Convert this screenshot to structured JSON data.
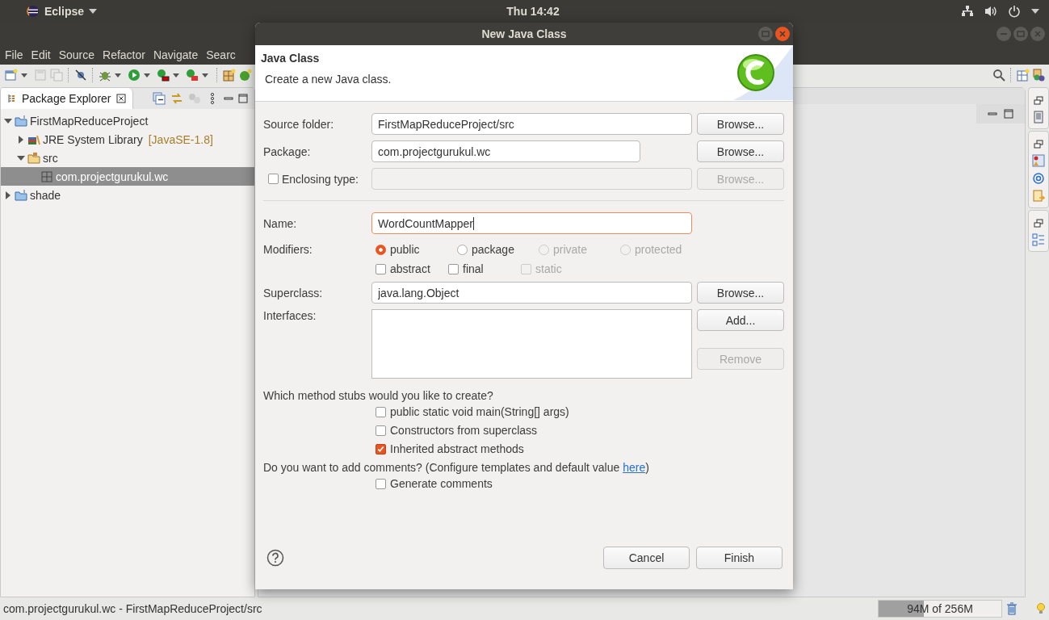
{
  "top_bar": {
    "app_menu": "Eclipse",
    "clock": "Thu 14:42"
  },
  "menu_bar": [
    "File",
    "Edit",
    "Source",
    "Refactor",
    "Navigate",
    "Searc"
  ],
  "explorer": {
    "title": "Package Explorer",
    "tree": [
      {
        "label": "FirstMapReduceProject",
        "kind": "project",
        "expanded": true,
        "selected": false,
        "children": [
          {
            "label": "JRE System Library",
            "suffix": "[JavaSE-1.8]",
            "kind": "library",
            "expanded": false,
            "selected": false
          },
          {
            "label": "src",
            "kind": "folder",
            "expanded": true,
            "selected": false,
            "children": [
              {
                "label": "com.projectgurukul.wc",
                "kind": "package",
                "selected": true
              }
            ]
          }
        ]
      },
      {
        "label": "shade",
        "kind": "project",
        "expanded": false,
        "selected": false
      }
    ]
  },
  "dialog": {
    "title": "New Java Class",
    "heading": "Java Class",
    "description": "Create a new Java class.",
    "source_folder": {
      "label": "Source folder:",
      "value": "FirstMapReduceProject/src",
      "button": {
        "label": "Browse...",
        "disabled": false
      }
    },
    "package": {
      "label": "Package:",
      "value": "com.projectgurukul.wc",
      "button": {
        "label": "Browse...",
        "disabled": false
      }
    },
    "enclosing_type": {
      "label": "Enclosing type:",
      "checked": false,
      "disabled": true,
      "button": {
        "label": "Browse...",
        "disabled": true
      }
    },
    "name": {
      "label": "Name:",
      "value": "WordCountMapper",
      "focused": true
    },
    "modifiers": {
      "label": "Modifiers:",
      "access": [
        {
          "label": "public",
          "selected": true,
          "disabled": false
        },
        {
          "label": "package",
          "selected": false,
          "disabled": false
        },
        {
          "label": "private",
          "selected": false,
          "disabled": true
        },
        {
          "label": "protected",
          "selected": false,
          "disabled": true
        }
      ],
      "flags": [
        {
          "label": "abstract",
          "checked": false,
          "disabled": false
        },
        {
          "label": "final",
          "checked": false,
          "disabled": false
        },
        {
          "label": "static",
          "checked": false,
          "disabled": true
        }
      ]
    },
    "superclass": {
      "label": "Superclass:",
      "value": "java.lang.Object",
      "button": {
        "label": "Browse...",
        "disabled": false
      }
    },
    "interfaces": {
      "label": "Interfaces:",
      "buttons": [
        {
          "label": "Add...",
          "disabled": false
        },
        {
          "label": "Remove",
          "disabled": true
        }
      ]
    },
    "stubs": {
      "prompt": "Which method stubs would you like to create?",
      "options": [
        {
          "label": "public static void main(String[] args)",
          "checked": false
        },
        {
          "label": "Constructors from superclass",
          "checked": false
        },
        {
          "label": "Inherited abstract methods",
          "checked": true
        }
      ]
    },
    "comments": {
      "prompt": "Do you want to add comments? (Configure templates and default value ",
      "link": "here",
      "prompt_end": ")",
      "options": [
        {
          "label": "Generate comments",
          "checked": false
        }
      ]
    },
    "buttons": [
      "Cancel",
      "Finish"
    ]
  },
  "status_bar": {
    "selection": "com.projectgurukul.wc - FirstMapReduceProject/src",
    "memory": {
      "reading": "94M of 256M",
      "level": 0.367
    }
  }
}
